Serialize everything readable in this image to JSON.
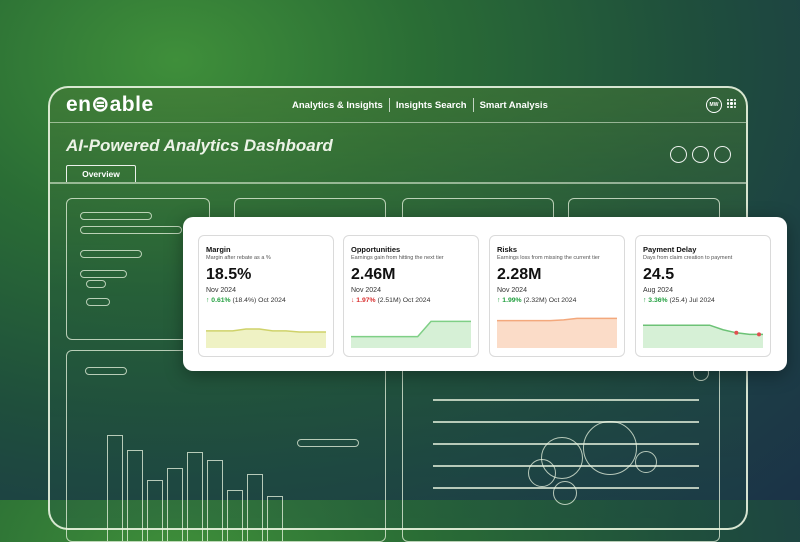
{
  "header": {
    "logo": "en⊜able",
    "nav": [
      "Analytics & Insights",
      "Insights Search",
      "Smart Analysis"
    ],
    "avatar_initials": "MW"
  },
  "page": {
    "title": "AI-Powered Analytics Dashboard",
    "tabs": [
      "Overview"
    ]
  },
  "kpi_cards": [
    {
      "title": "Margin",
      "subtitle": "Margin after rebate as a %",
      "value": "18.5%",
      "period": "Nov 2024",
      "direction": "up",
      "change_pct": "0.61%",
      "change_detail": " (18.4%) Oct 2024",
      "fill_color": "#eff2c4",
      "line_color": "#cfd26a"
    },
    {
      "title": "Opportunities",
      "subtitle": "Earnings gain from hitting the next tier",
      "value": "2.46M",
      "period": "Nov 2024",
      "direction": "down",
      "change_pct": "1.97%",
      "change_detail": " (2.51M) Oct 2024",
      "fill_color": "#d6f0d6",
      "line_color": "#7fcf86"
    },
    {
      "title": "Risks",
      "subtitle": "Earnings loss from missing the current tier",
      "value": "2.28M",
      "period": "Nov 2024",
      "direction": "up",
      "change_pct": "1.99%",
      "change_detail": " (2.32M) Oct 2024",
      "fill_color": "#fbdcc8",
      "line_color": "#f3a87c"
    },
    {
      "title": "Payment Delay",
      "subtitle": "Days from claim creation to payment",
      "value": "24.5",
      "period": "Aug 2024",
      "direction": "up",
      "change_pct": "3.36%",
      "change_detail": " (25.4) Jul 2024",
      "fill_color": "#d6f0d6",
      "line_color": "#6cc276"
    }
  ],
  "sparklines": [
    [
      0.45,
      0.45,
      0.45,
      0.5,
      0.5,
      0.45,
      0.45,
      0.42,
      0.42,
      0.42
    ],
    [
      0.3,
      0.3,
      0.3,
      0.3,
      0.3,
      0.3,
      0.7,
      0.7,
      0.7,
      0.7
    ],
    [
      0.72,
      0.72,
      0.72,
      0.72,
      0.72,
      0.74,
      0.78,
      0.78,
      0.78,
      0.78
    ],
    [
      0.6,
      0.6,
      0.6,
      0.6,
      0.6,
      0.6,
      0.48,
      0.4,
      0.36,
      0.36
    ]
  ]
}
